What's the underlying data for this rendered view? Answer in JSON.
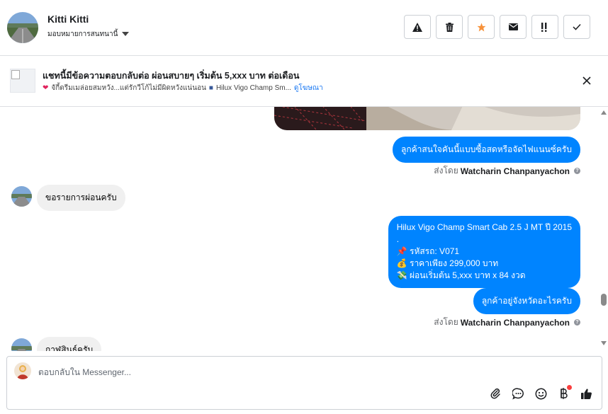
{
  "header": {
    "name": "Kitti Kitti",
    "assign_label": "มอบหมายการสนทนานี้",
    "actions": [
      {
        "name": "report-button",
        "icon": "warning-icon"
      },
      {
        "name": "delete-button",
        "icon": "trash-icon"
      },
      {
        "name": "star-button",
        "icon": "star-icon"
      },
      {
        "name": "mark-unread-button",
        "icon": "envelope-icon"
      },
      {
        "name": "follow-up-button",
        "icon": "flag-icon"
      },
      {
        "name": "mark-done-button",
        "icon": "check-icon"
      }
    ]
  },
  "ad": {
    "title": "แชทนี้มีข้อความตอบกลับต่อ ผ่อนสบายๆ เริ่มต้น 5,xxx บาท ต่อเดือน",
    "snippet": "จักี้ดรีมเมล่อยสมหวัง...แต่รักวีโก้ไม่มีผิดหวังแน่นอน",
    "product": "Hilux Vigo Champ Sm...",
    "link": "ดูโฆษณา"
  },
  "messages": {
    "m1": "ลูกค้าสนใจคันนี้แบบซื้อสดหรือจัดไฟแนนซ์ครับ",
    "sent_by_prefix": "ส่งโดย",
    "sent_by_name": "Watcharin Chanpanyachon",
    "m2": "ขอรายการผ่อนครับ",
    "m3_title": "Hilux Vigo Champ Smart Cab 2.5 J MT ปี 2015",
    "m3_dot": ".",
    "m3_code": "รหัสรถ: V071",
    "m3_price": "ราคาเพียง 299,000 บาท",
    "m3_install": "ผ่อนเริ่มต้น 5,xxx บาท x 84 งวด",
    "m4": "ลูกค้าอยู่จังหวัดอะไรครับ",
    "m5": "กาฬสินธุ์ครับ"
  },
  "composer": {
    "placeholder": "ตอบกลับใน Messenger..."
  },
  "colors": {
    "accent": "#0084ff",
    "star": "#f7923b",
    "link": "#1877f2"
  }
}
